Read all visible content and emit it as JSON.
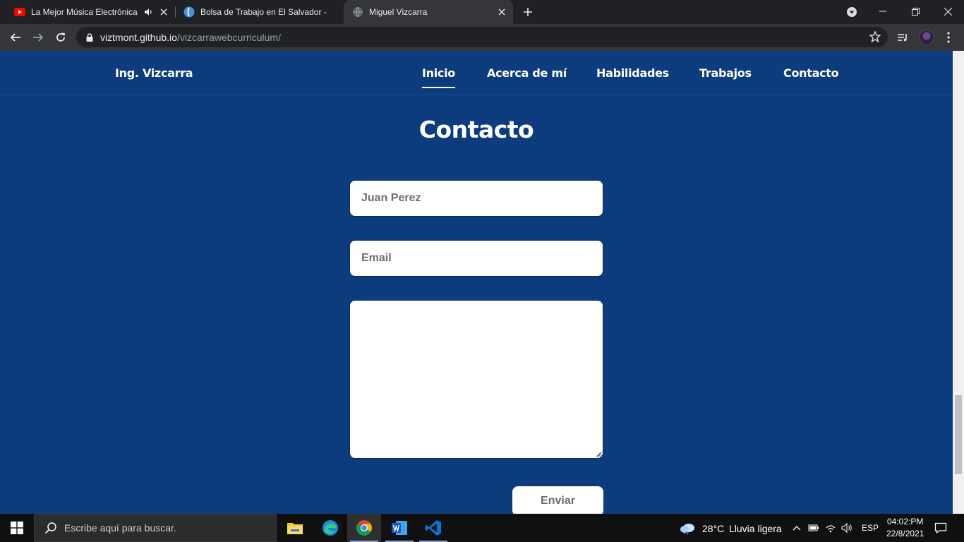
{
  "browser": {
    "tabs": [
      {
        "title": "La Mejor Música Electrónica",
        "icon": "youtube-icon",
        "audio": true,
        "active": false
      },
      {
        "title": "Bolsa de Trabajo en El Salvador -",
        "icon": "site-favicon",
        "audio": false,
        "active": false
      },
      {
        "title": "Miguel Vizcarra",
        "icon": "globe-icon",
        "audio": false,
        "active": true
      }
    ],
    "url_host": "viztmont.github.io",
    "url_path": "/vizcarrawebcurriculum/"
  },
  "site": {
    "brand": "Ing. Vizcarra",
    "nav": [
      "Inicio",
      "Acerca de mí",
      "Habilidades",
      "Trabajos",
      "Contacto"
    ],
    "active_nav": "Inicio",
    "bg_color": "#0d3c7e"
  },
  "contact": {
    "title": "Contacto",
    "name_placeholder": "Juan Perez",
    "email_placeholder": "Email",
    "message_value": "",
    "submit_label": "Enviar"
  },
  "taskbar": {
    "search_placeholder": "Escribe aquí para buscar.",
    "weather_temp": "28°C",
    "weather_desc": "Lluvia ligera",
    "lang": "ESP",
    "time": "04:02:PM",
    "date": "22/8/2021"
  }
}
